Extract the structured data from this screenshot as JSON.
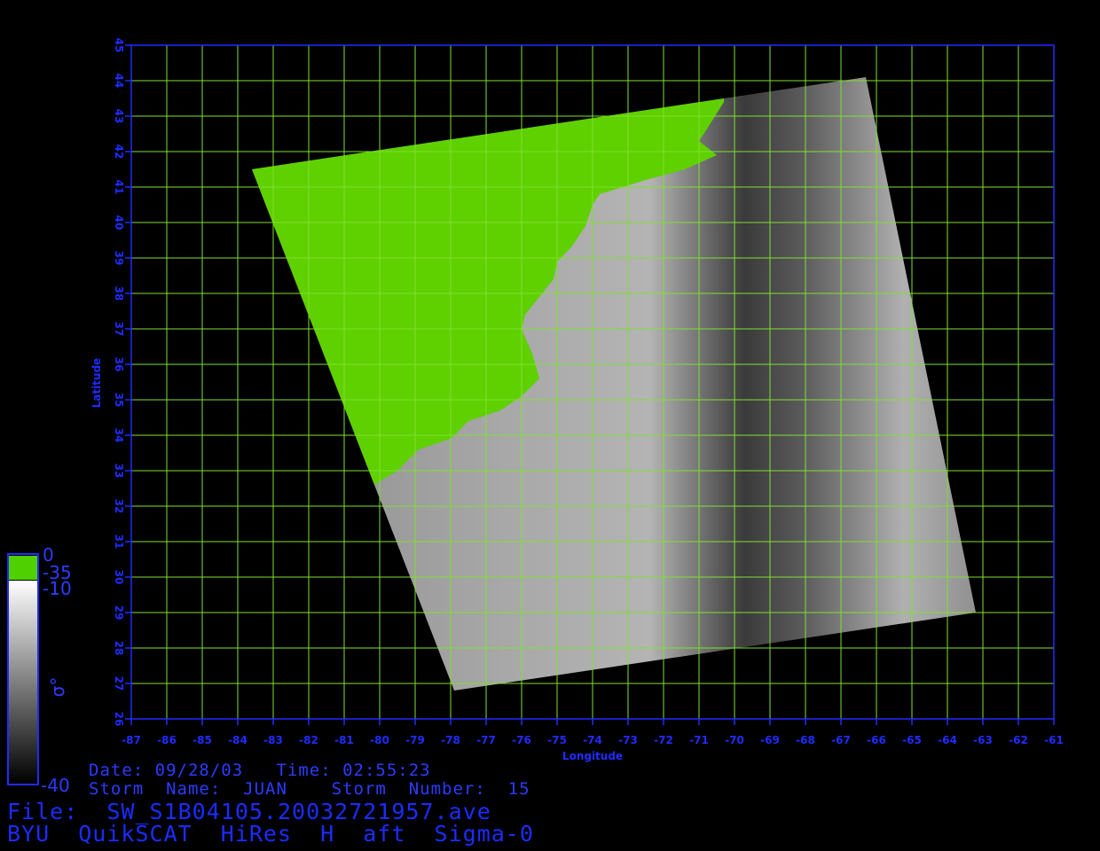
{
  "map": {
    "xlabel": "Longitude",
    "ylabel": "Latitude",
    "lon_range": [
      -87,
      -61
    ],
    "lat_range": [
      26,
      45
    ],
    "lon_ticks": [
      "-87",
      "-86",
      "-85",
      "-84",
      "-83",
      "-82",
      "-81",
      "-80",
      "-79",
      "-78",
      "-77",
      "-76",
      "-75",
      "-74",
      "-73",
      "-72",
      "-71",
      "-70",
      "-69",
      "-68",
      "-67",
      "-66",
      "-65",
      "-64",
      "-63",
      "-62",
      "-61"
    ],
    "lat_ticks": [
      "26",
      "27",
      "28",
      "29",
      "30",
      "31",
      "32",
      "33",
      "34",
      "35",
      "36",
      "37",
      "38",
      "39",
      "40",
      "41",
      "42",
      "43",
      "44",
      "45"
    ],
    "grid_color": "#7fe030",
    "frame_color": "#1f2cff",
    "land_color": "#5fd000",
    "swath_corners_lonlat": [
      [
        -83.6,
        41.5
      ],
      [
        -66.3,
        44.1
      ],
      [
        -63.2,
        29.0
      ],
      [
        -77.9,
        26.8
      ]
    ]
  },
  "colorbar": {
    "symbol": "σ°",
    "land_top": "0",
    "land_bottom": "-35",
    "scale_top": "-10",
    "scale_bottom": "-40",
    "land_color": "#4fd000",
    "outline_color": "#1f2cff"
  },
  "meta": {
    "date_line": "Date: 09/28/03   Time: 02:55:23",
    "storm_line": "Storm  Name:  JUAN    Storm  Number:  15"
  },
  "title": {
    "file_line": "File:  SW_S1B04105.20032721957.ave",
    "product_line": "BYU  QuikSCAT  HiRes  H  aft  Sigma-0"
  }
}
